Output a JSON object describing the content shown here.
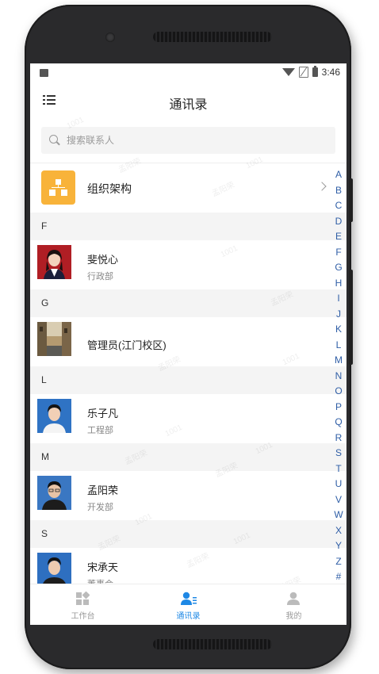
{
  "status_bar": {
    "time": "3:46"
  },
  "header": {
    "title": "通讯录",
    "menu_icon": "list-icon"
  },
  "search": {
    "placeholder": "搜索联系人",
    "value": ""
  },
  "org": {
    "label": "组织架构",
    "icon": "org-chart-icon"
  },
  "sections": [
    {
      "letter": "F",
      "contacts": [
        {
          "name": "斐悦心",
          "dept": "行政部"
        }
      ]
    },
    {
      "letter": "G",
      "contacts": [
        {
          "name": "管理员(江门校区)",
          "dept": ""
        }
      ]
    },
    {
      "letter": "L",
      "contacts": [
        {
          "name": "乐子凡",
          "dept": "工程部"
        }
      ]
    },
    {
      "letter": "M",
      "contacts": [
        {
          "name": "孟阳荣",
          "dept": "开发部"
        }
      ]
    },
    {
      "letter": "S",
      "contacts": [
        {
          "name": "宋承天",
          "dept": "董事会"
        }
      ]
    }
  ],
  "index_letters": [
    "A",
    "B",
    "C",
    "D",
    "E",
    "F",
    "G",
    "H",
    "I",
    "J",
    "K",
    "L",
    "M",
    "N",
    "O",
    "P",
    "Q",
    "R",
    "S",
    "T",
    "U",
    "V",
    "W",
    "X",
    "Y",
    "Z",
    "#"
  ],
  "bottom_nav": [
    {
      "label": "工作台",
      "icon": "dashboard-icon",
      "active": false
    },
    {
      "label": "通讯录",
      "icon": "contacts-icon",
      "active": true
    },
    {
      "label": "我的",
      "icon": "profile-icon",
      "active": false
    }
  ],
  "watermark": {
    "text_name": "孟阳荣",
    "text_id": "1001"
  },
  "colors": {
    "accent": "#1e88e5",
    "org_icon_bg": "#f8b33a",
    "index_letters": "#2f5ea6",
    "section_bg": "#f4f4f4"
  }
}
